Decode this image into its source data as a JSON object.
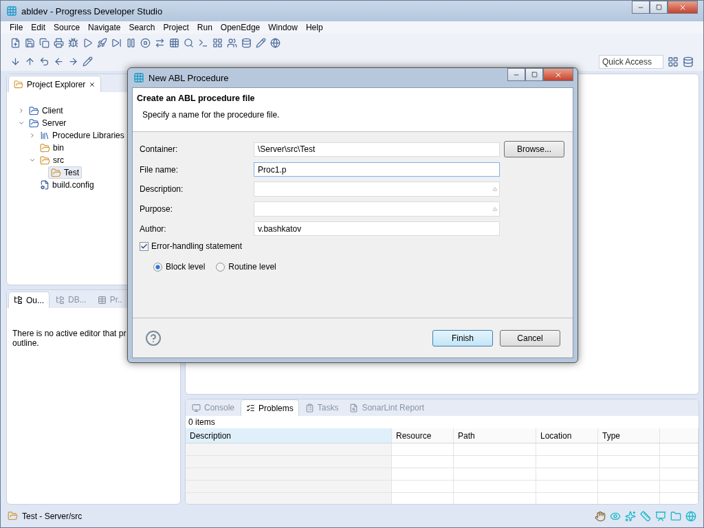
{
  "window": {
    "title": "abldev - Progress Developer Studio"
  },
  "menu": [
    "File",
    "Edit",
    "Source",
    "Navigate",
    "Search",
    "Project",
    "Run",
    "OpenEdge",
    "Window",
    "Help"
  ],
  "quick_access": {
    "placeholder": "Quick Access"
  },
  "project_explorer": {
    "tab": "Project Explorer",
    "tree": [
      {
        "label": "Client",
        "kind": "project",
        "expanded": false,
        "selected": false
      },
      {
        "label": "Server",
        "kind": "project",
        "expanded": true,
        "selected": false,
        "children": [
          {
            "label": "Procedure Libraries",
            "kind": "library",
            "expanded": false,
            "selected": false
          },
          {
            "label": "bin",
            "kind": "folder",
            "selected": false
          },
          {
            "label": "src",
            "kind": "folder",
            "expanded": true,
            "selected": false,
            "children": [
              {
                "label": "Test",
                "kind": "folder",
                "selected": true
              }
            ]
          },
          {
            "label": "build.config",
            "kind": "file",
            "selected": false
          }
        ]
      }
    ]
  },
  "outline": {
    "tabs": [
      {
        "label": "Ou...",
        "selected": true
      },
      {
        "label": "DB...",
        "selected": false
      },
      {
        "label": "Pr..",
        "selected": false
      }
    ],
    "message": [
      "There is no active editor that pr",
      "outline."
    ]
  },
  "problems": {
    "tabs": [
      {
        "label": "Console",
        "selected": false
      },
      {
        "label": "Problems",
        "selected": true
      },
      {
        "label": "Tasks",
        "selected": false
      },
      {
        "label": "SonarLint Report",
        "selected": false
      }
    ],
    "count": "0 items",
    "columns": [
      "Description",
      "Resource",
      "Path",
      "Location",
      "Type"
    ]
  },
  "status_bar": "Test - Server/src",
  "dialog": {
    "title": "New ABL Procedure",
    "heading": "Create an ABL procedure file",
    "subtitle": "Specify a name for the procedure file.",
    "fields": [
      {
        "label": "Container:",
        "value": "\\Server\\src\\Test",
        "kind": "text",
        "button": "Browse..."
      },
      {
        "label": "File name:",
        "value": "Proc1.p",
        "kind": "text",
        "focused": true
      },
      {
        "label": "Description:",
        "kind": "spinner"
      },
      {
        "label": "Purpose:",
        "kind": "spinner"
      },
      {
        "label": "Author:",
        "value": "v.bashkatov",
        "kind": "text"
      }
    ],
    "checkbox": {
      "label": "Error-handling statement",
      "checked": true
    },
    "radios": [
      {
        "label": "Block level",
        "selected": true
      },
      {
        "label": "Routine level",
        "selected": false
      }
    ],
    "buttons": [
      {
        "label": "Finish",
        "default": true
      },
      {
        "label": "Cancel",
        "default": false
      }
    ]
  }
}
